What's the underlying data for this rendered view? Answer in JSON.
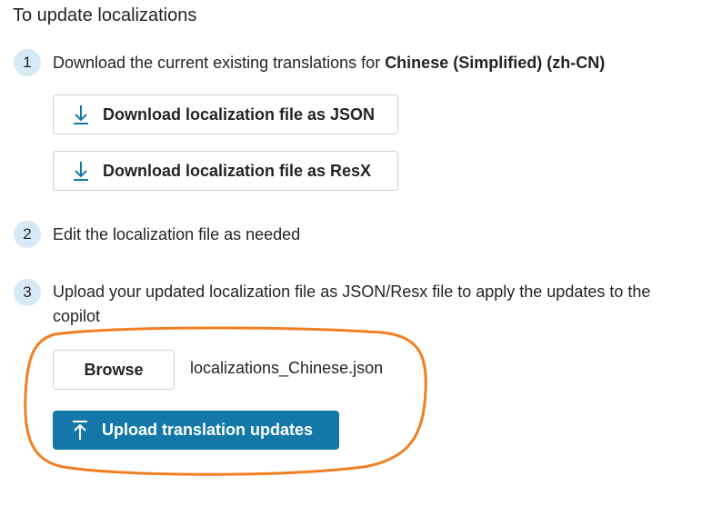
{
  "section_title": "To update localizations",
  "steps": [
    {
      "number": "1",
      "text_prefix": "Download the current existing translations for ",
      "text_bold": "Chinese (Simplified) (zh-CN)"
    },
    {
      "number": "2",
      "text": "Edit the localization file as needed"
    },
    {
      "number": "3",
      "text_line1": "Upload your updated localization file as JSON/Resx file to apply the updates to the",
      "text_line2": "copilot"
    }
  ],
  "buttons": {
    "download_json": "Download localization file as JSON",
    "download_resx": "Download localization file as ResX",
    "browse": "Browse",
    "upload": "Upload translation updates"
  },
  "selected_file": "localizations_Chinese.json",
  "icons": {
    "download": "download-arrow-icon",
    "upload": "upload-arrow-icon"
  },
  "colors": {
    "primary": "#1377a8",
    "icon_accent": "#1377a8",
    "step_badge": "#d6e9f5",
    "highlight": "#f07f23"
  }
}
